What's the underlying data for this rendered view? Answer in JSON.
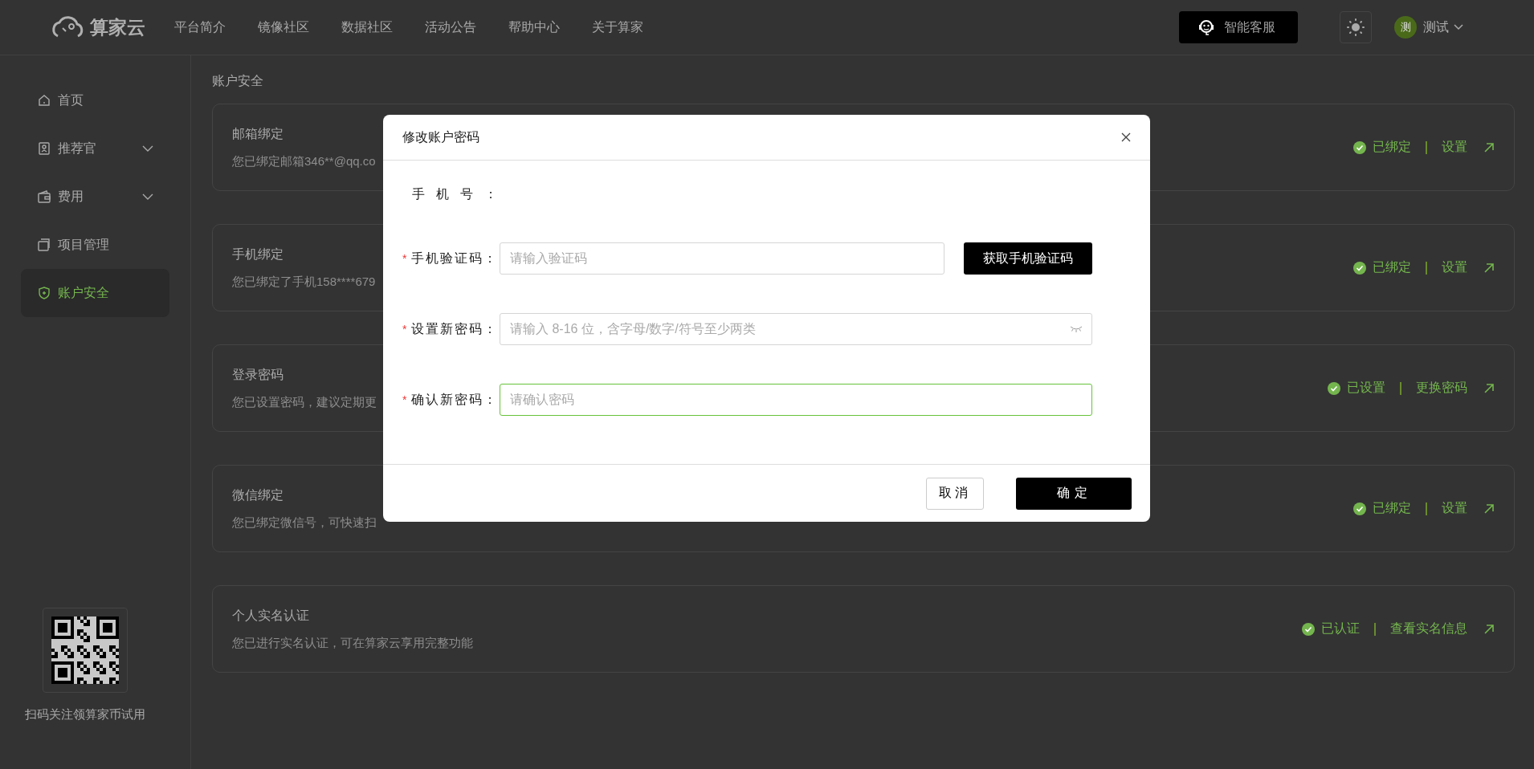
{
  "header": {
    "logo": "算家云",
    "nav": [
      {
        "label": "平台简介"
      },
      {
        "label": "镜像社区"
      },
      {
        "label": "数据社区"
      },
      {
        "label": "活动公告"
      },
      {
        "label": "帮助中心"
      },
      {
        "label": "关于算家"
      }
    ],
    "support_button": "智能客服",
    "user": {
      "avatar": "测",
      "name": "测试"
    }
  },
  "sidebar": {
    "items": [
      {
        "label": "首页",
        "kind": "link",
        "selected": false
      },
      {
        "label": "推荐官",
        "kind": "group",
        "selected": false
      },
      {
        "label": "费用",
        "kind": "group",
        "selected": false
      },
      {
        "label": "项目管理",
        "kind": "link",
        "selected": false
      },
      {
        "label": "账户安全",
        "kind": "link",
        "selected": true
      }
    ],
    "qr_caption": "扫码关注领算家币试用"
  },
  "breadcrumb": "账户安全",
  "cards": [
    {
      "title": "邮箱绑定",
      "description": "您已绑定邮箱346**@qq.co",
      "status": "已绑定",
      "action": "设置"
    },
    {
      "title": "手机绑定",
      "description": "您已绑定了手机158****679",
      "status": "已绑定",
      "action": "设置"
    },
    {
      "title": "登录密码",
      "description": "您已设置密码，建议定期更",
      "status": "已设置",
      "action": "更换密码"
    },
    {
      "title": "微信绑定",
      "description": "您已绑定微信号，可快速扫",
      "status": "已绑定",
      "action": "设置"
    },
    {
      "title": "个人实名认证",
      "description": "您已进行实名认证，可在算家云享用完整功能",
      "status": "已认证",
      "action": "查看实名信息"
    }
  ],
  "dialog": {
    "title": "修改账户密码",
    "fields": [
      {
        "kind": "static",
        "label": "手机号：",
        "required": false
      },
      {
        "kind": "code",
        "label": "手机验证码：",
        "required": true,
        "placeholder": "请输入验证码",
        "button": "获取手机验证码",
        "focused": false
      },
      {
        "kind": "password",
        "label": "设置新密码：",
        "required": true,
        "placeholder": "请输入 8-16 位，含字母/数字/符号至少两类",
        "focused": false
      },
      {
        "kind": "text",
        "label": "确认新密码：",
        "required": true,
        "placeholder": "请确认密码",
        "focused": true
      }
    ],
    "required_mark": "*",
    "cancel": "取消",
    "confirm": "确定"
  }
}
